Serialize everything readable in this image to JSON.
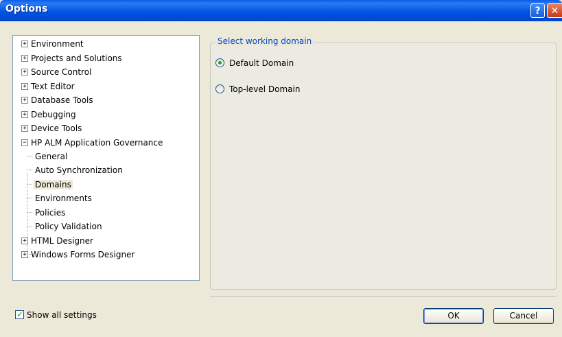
{
  "window": {
    "title": "Options",
    "help_glyph": "?",
    "close_glyph": "✕"
  },
  "tree": {
    "items": [
      {
        "label": "Environment",
        "expander": "+"
      },
      {
        "label": "Projects and Solutions",
        "expander": "+"
      },
      {
        "label": "Source Control",
        "expander": "+"
      },
      {
        "label": "Text Editor",
        "expander": "+"
      },
      {
        "label": "Database Tools",
        "expander": "+"
      },
      {
        "label": "Debugging",
        "expander": "+"
      },
      {
        "label": "Device Tools",
        "expander": "+"
      },
      {
        "label": "HP ALM Application Governance",
        "expander": "−"
      },
      {
        "label": "General"
      },
      {
        "label": "Auto Synchronization"
      },
      {
        "label": "Domains",
        "selected": true
      },
      {
        "label": "Environments"
      },
      {
        "label": "Policies"
      },
      {
        "label": "Policy Validation"
      },
      {
        "label": "HTML Designer",
        "expander": "+"
      },
      {
        "label": "Windows Forms Designer",
        "expander": "+"
      }
    ]
  },
  "domain_group": {
    "legend": "Select working domain",
    "options": [
      {
        "label": "Default Domain",
        "checked": true
      },
      {
        "label": "Top-level Domain",
        "checked": false
      }
    ]
  },
  "footer": {
    "show_all_label": "Show all settings",
    "show_all_checked": true,
    "ok_label": "OK",
    "cancel_label": "Cancel"
  },
  "colors": {
    "title_bar": "#0055e5",
    "legend_text": "#0046d5",
    "check_mark": "#21a121",
    "dialog_bg": "#ece9d8"
  }
}
